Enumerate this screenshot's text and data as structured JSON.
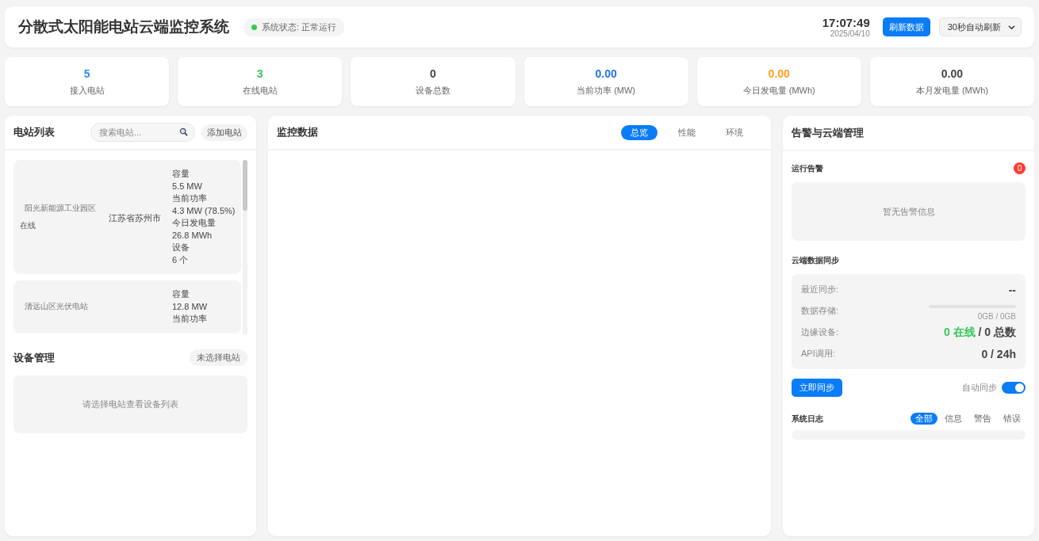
{
  "header": {
    "title": "分散式太阳能电站云端监控系统",
    "status": {
      "label": "系统状态: 正常运行",
      "color": "#34c759"
    },
    "time": "17:07:49",
    "date": "2025/04/10",
    "refresh_button": "刷新数据",
    "interval_select": {
      "value": "30秒自动刷新"
    }
  },
  "stats": [
    {
      "value": "5",
      "label": "接入电站",
      "color": "#2b8ef0"
    },
    {
      "value": "3",
      "label": "在线电站",
      "color": "#34c759"
    },
    {
      "value": "0",
      "label": "设备总数",
      "color": "#444444"
    },
    {
      "value": "0.00",
      "label": "当前功率 (MW)",
      "color": "#1f74d6"
    },
    {
      "value": "0.00",
      "label": "今日发电量 (MWh)",
      "color": "#ff9f1a"
    },
    {
      "value": "0.00",
      "label": "本月发电量 (MWh)",
      "color": "#444444"
    }
  ],
  "stations_panel": {
    "title": "电站列表",
    "search": {
      "placeholder": "搜索电站..."
    },
    "add_button": "添加电站",
    "stations": [
      {
        "name": "阳光新能源工业园区",
        "status": "在线",
        "location": "江苏省苏州市",
        "metrics": [
          "容量",
          "5.5 MW",
          "当前功率",
          "4.3 MW (78.5%)",
          "今日发电量",
          "26.8 MWh",
          "设备",
          "6 个"
        ]
      },
      {
        "name": "清远山区光伏电站",
        "metrics": [
          "容量",
          "12.8 MW",
          "当前功率"
        ]
      }
    ]
  },
  "devices_panel": {
    "title": "设备管理",
    "badge": "未选择电站",
    "empty": "请选择电站查看设备列表"
  },
  "monitor_panel": {
    "title": "监控数据",
    "tabs": [
      {
        "label": "总览",
        "selected": true
      },
      {
        "label": "性能",
        "selected": false
      },
      {
        "label": "环境",
        "selected": false
      }
    ]
  },
  "alerts_panel": {
    "title": "告警与云端管理",
    "alarms": {
      "title": "运行告警",
      "count": "0",
      "empty": "暂无告警信息"
    },
    "sync": {
      "title": "云端数据同步",
      "rows": [
        {
          "kind": "text",
          "label": "最近同步:",
          "value": "--"
        },
        {
          "kind": "storage",
          "label": "数据存储:",
          "level": 0,
          "value": "0GB / 0GB"
        },
        {
          "kind": "devices",
          "label": "边缘设备:",
          "online": "0 在线",
          "total": "/ 0 总数"
        },
        {
          "kind": "text",
          "label": "API调用:",
          "value": "0 / 24h"
        }
      ]
    },
    "sync_button": "立即同步",
    "auto_sync": {
      "label": "自动同步",
      "on": true
    },
    "log": {
      "title": "系统日志",
      "filters": [
        {
          "label": "全部",
          "selected": true
        },
        {
          "label": "信息",
          "selected": false
        },
        {
          "label": "警告",
          "selected": false
        },
        {
          "label": "错误",
          "selected": false
        }
      ]
    }
  }
}
